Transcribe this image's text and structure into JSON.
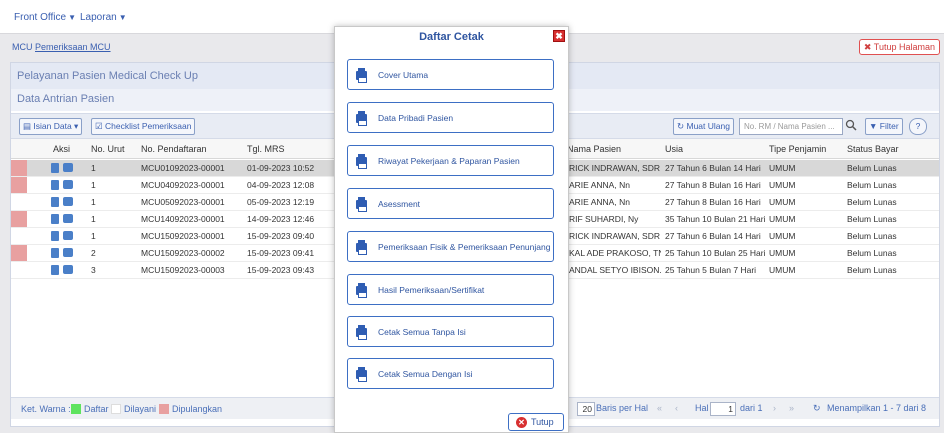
{
  "topnav": {
    "front_office": "Front Office",
    "laporan": "Laporan"
  },
  "breadcrumb": {
    "root": "MCU",
    "current": "Pemeriksaan MCU"
  },
  "tutup_halaman": "✖ Tutup Halaman",
  "panel": {
    "title": "Pelayanan Pasien Medical Check Up",
    "subtitle": "Data Antrian Pasien"
  },
  "toolbar": {
    "isian_data": "Isian Data",
    "checklist": "Checklist Pemeriksaan",
    "muat_ulang": "Muat Ulang",
    "search_placeholder": "No. RM / Nama Pasien ...",
    "filter": "Filter",
    "help": "?"
  },
  "table": {
    "headers": [
      "Aksi",
      "No. Urut",
      "No. Pendaftaran",
      "Tgl. MRS",
      "Nama Pasien",
      "Usia",
      "Tipe Penjamin",
      "Status Bayar"
    ],
    "rows": [
      {
        "marker": "#e8a0a0",
        "no": "1",
        "reg": "MCU01092023-00001",
        "tgl": "01-09-2023 10:52",
        "nama": "RICK INDRAWAN, SDR",
        "usia": "27 Tahun 6 Bulan 14 Hari",
        "tipe": "UMUM",
        "status": "Belum Lunas"
      },
      {
        "marker": "#e8a0a0",
        "no": "1",
        "reg": "MCU04092023-00001",
        "tgl": "04-09-2023 12:08",
        "nama": "ARIE ANNA, Nn",
        "usia": "27 Tahun 8 Bulan 16 Hari",
        "tipe": "UMUM",
        "status": "Belum Lunas"
      },
      {
        "marker": "",
        "no": "1",
        "reg": "MCU05092023-00001",
        "tgl": "05-09-2023 12:19",
        "nama": "ARIE ANNA, Nn",
        "usia": "27 Tahun 8 Bulan 16 Hari",
        "tipe": "UMUM",
        "status": "Belum Lunas"
      },
      {
        "marker": "#e8a0a0",
        "no": "1",
        "reg": "MCU14092023-00001",
        "tgl": "14-09-2023 12:46",
        "nama": "RIF SUHARDI, Ny",
        "usia": "35 Tahun 10 Bulan 21 Hari",
        "tipe": "UMUM",
        "status": "Belum Lunas"
      },
      {
        "marker": "",
        "no": "1",
        "reg": "MCU15092023-00001",
        "tgl": "15-09-2023 09:40",
        "nama": "RICK INDRAWAN, SDR",
        "usia": "27 Tahun 6 Bulan 14 Hari",
        "tipe": "UMUM",
        "status": "Belum Lunas"
      },
      {
        "marker": "#e8a0a0",
        "no": "2",
        "reg": "MCU15092023-00002",
        "tgl": "15-09-2023 09:41",
        "nama": "KAL ADE PRAKOSO, TN",
        "usia": "25 Tahun 10 Bulan 25 Hari",
        "tipe": "UMUM",
        "status": "Belum Lunas"
      },
      {
        "marker": "",
        "no": "3",
        "reg": "MCU15092023-00003",
        "tgl": "15-09-2023 09:43",
        "nama": "ANDAL SETYO IBISON...",
        "usia": "25 Tahun 5 Bulan 7 Hari",
        "tipe": "UMUM",
        "status": "Belum Lunas"
      }
    ]
  },
  "footer": {
    "ket_warna": "Ket. Warna :",
    "daftar": "Daftar",
    "dilayani": "Dilayani",
    "dipulangkan": "Dipulangkan",
    "page_size": "20",
    "baris_per_hal": "Baris per Hal",
    "hal": "Hal",
    "page": "1",
    "dari": "dari 1",
    "menampilkan": "Menampilkan 1 - 7 dari 8",
    "colors": {
      "daftar": "#5ee35e",
      "dilayani": "#ffffff",
      "dipulangkan": "#e8a0a0"
    }
  },
  "modal": {
    "title": "Daftar Cetak",
    "close": "✖",
    "buttons": [
      "Cover Utama",
      "Data Pribadi Pasien",
      "Riwayat Pekerjaan & Paparan Pasien",
      "Asessment",
      "Pemeriksaan Fisik & Pemeriksaan Penunjang",
      "Hasil Pemeriksaan/Sertifikat",
      "Cetak Semua Tanpa Isi",
      "Cetak Semua Dengan Isi"
    ],
    "tutup": "Tutup"
  }
}
